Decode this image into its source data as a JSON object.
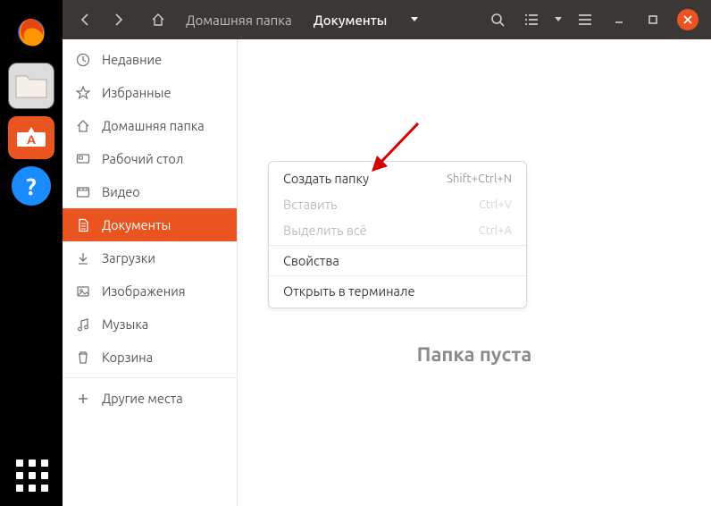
{
  "breadcrumbs": {
    "home": "Домашняя папка",
    "current": "Документы"
  },
  "sidebar": {
    "items": [
      {
        "label": "Недавние"
      },
      {
        "label": "Избранные"
      },
      {
        "label": "Домашняя папка"
      },
      {
        "label": "Рабочий стол"
      },
      {
        "label": "Видео"
      },
      {
        "label": "Документы"
      },
      {
        "label": "Загрузки"
      },
      {
        "label": "Изображения"
      },
      {
        "label": "Музыка"
      },
      {
        "label": "Корзина"
      },
      {
        "label": "Другие места"
      }
    ]
  },
  "content": {
    "empty_text": "Папка пуста"
  },
  "context_menu": {
    "items": [
      {
        "label": "Создать папку",
        "accel": "Shift+Ctrl+N",
        "disabled": false
      },
      {
        "label": "Вставить",
        "accel": "Ctrl+V",
        "disabled": true
      },
      {
        "label": "Выделить всё",
        "accel": "Ctrl+A",
        "disabled": true
      },
      {
        "label": "Свойства",
        "accel": "",
        "disabled": false
      },
      {
        "label": "Открыть в терминале",
        "accel": "",
        "disabled": false
      }
    ]
  },
  "dock": {
    "help_glyph": "?"
  }
}
